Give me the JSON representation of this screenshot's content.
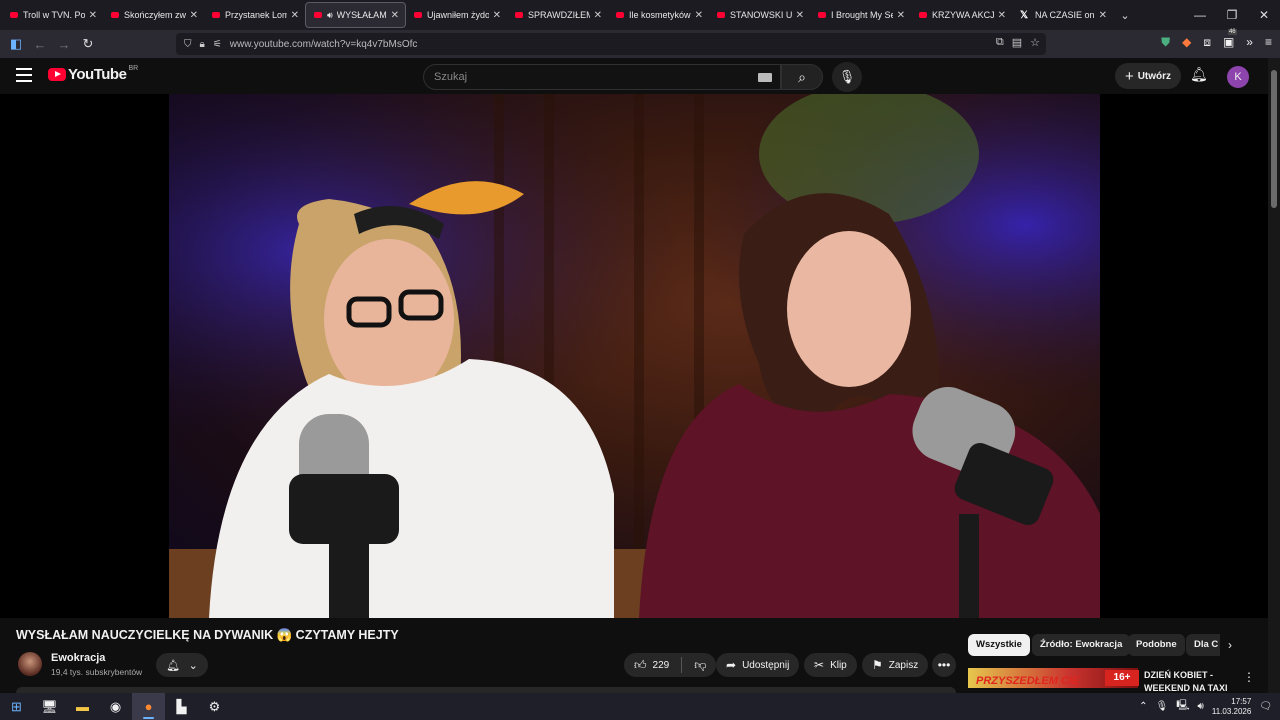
{
  "browser": {
    "tabs": [
      {
        "title": "Troll w TVN. Poczw",
        "icon": "youtube",
        "active": false
      },
      {
        "title": "Skończyłem związ",
        "icon": "youtube",
        "active": false
      },
      {
        "title": "Przystanek Lomba",
        "icon": "youtube",
        "active": false
      },
      {
        "title": "WYSŁAŁAM N",
        "icon": "youtube",
        "active": true,
        "playing": true
      },
      {
        "title": "Ujawniłem żydow",
        "icon": "youtube",
        "active": false
      },
      {
        "title": "SPRAWDZIŁEM CZ",
        "icon": "youtube",
        "active": false
      },
      {
        "title": "Ile kosmetyków w",
        "icon": "youtube",
        "active": false
      },
      {
        "title": "STANOWSKI UJAW",
        "icon": "youtube",
        "active": false
      },
      {
        "title": "I Brought My Secr",
        "icon": "youtube",
        "active": false
      },
      {
        "title": "KRZYWA AKCJA #",
        "icon": "youtube",
        "active": false
      },
      {
        "title": "NA CZASIE on X: \"",
        "icon": "x",
        "active": false
      }
    ],
    "url": "www.youtube.com/watch?v=kq4v7bMsOfc",
    "extension_badge": "46"
  },
  "youtube": {
    "logo_text": "YouTube",
    "logo_region": "BR",
    "search_placeholder": "Szukaj",
    "create_label": "Utwórz",
    "avatar_letter": "K"
  },
  "video": {
    "title": "WYSŁAŁAM NAUCZYCIELKĘ NA DYWANIK 😱 CZYTAMY HEJTY",
    "channel": "Ewokracja",
    "subscribers": "19,4 tys. subskrybentów",
    "likes": "229",
    "share_label": "Udostępnij",
    "clip_label": "Klip",
    "save_label": "Zapisz"
  },
  "chips": [
    "Wszystkie",
    "Źródło: Ewokracja",
    "Podobne",
    "Dla C"
  ],
  "recommendation": {
    "thumb_text": "PRZYSZEDŁEM CIĘ",
    "badge": "16+",
    "title": "DZIEŃ KOBIET - WEEKEND NA TAXI"
  },
  "taskbar": {
    "time": "17:57",
    "date": "11.03.2026"
  },
  "colors": {
    "youtube_red": "#ff0033",
    "bg": "#0f0f0f",
    "avatar": "#8e44ad"
  }
}
